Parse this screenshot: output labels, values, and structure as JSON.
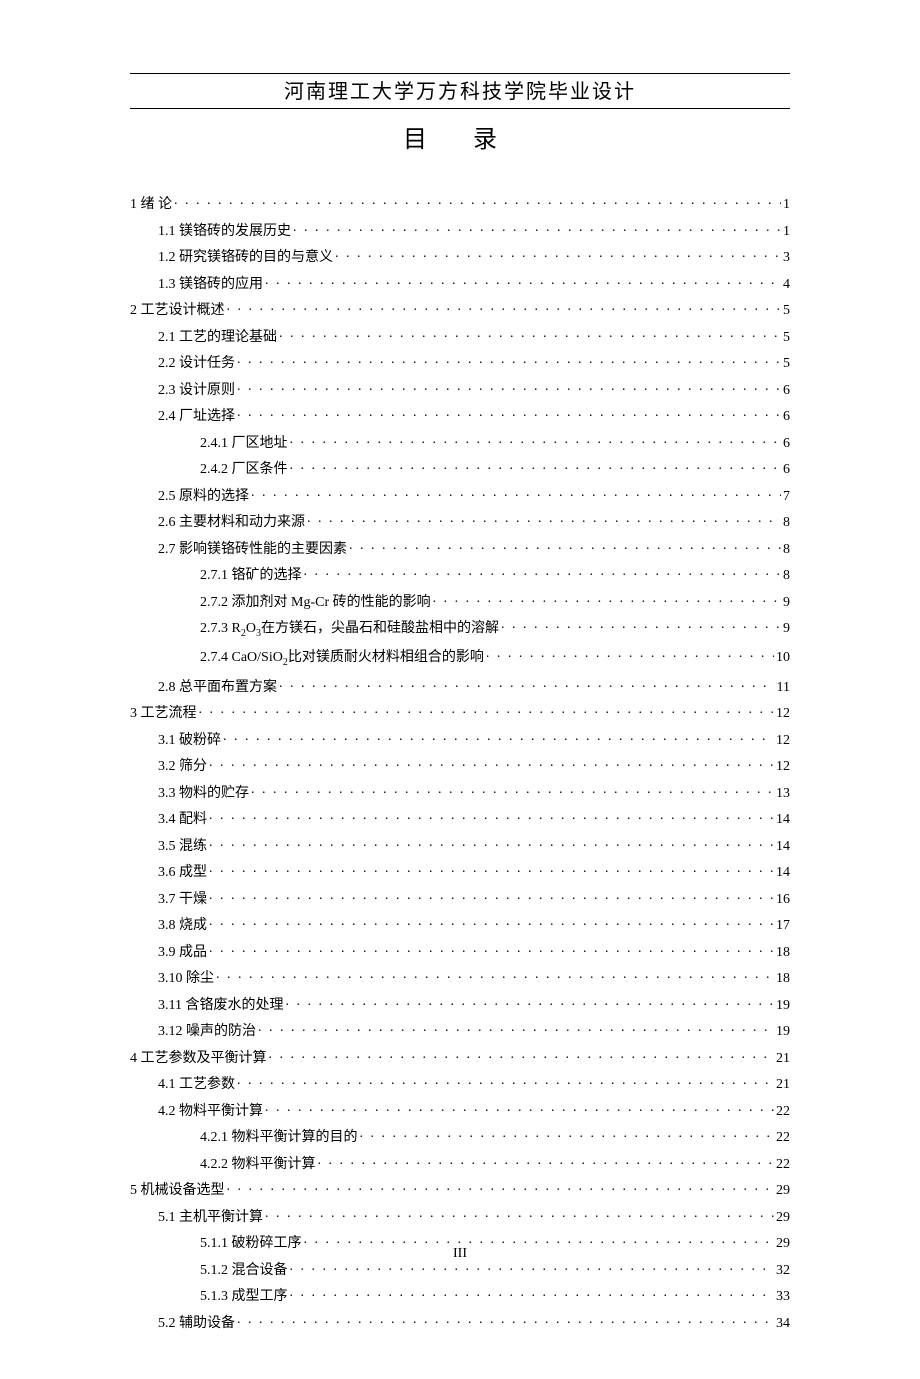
{
  "header": "河南理工大学万方科技学院毕业设计",
  "title": "目  录",
  "page_number": "III",
  "toc": [
    {
      "level": 1,
      "label": "1 绪  论",
      "sub": [],
      "page": "1"
    },
    {
      "level": 2,
      "label": "1.1 镁铬砖的发展历史",
      "sub": [],
      "page": "1"
    },
    {
      "level": 2,
      "label": "1.2 研究镁铬砖的目的与意义",
      "sub": [],
      "page": "3"
    },
    {
      "level": 2,
      "label": "1.3 镁铬砖的应用",
      "sub": [],
      "page": "4"
    },
    {
      "level": 1,
      "label": "2 工艺设计概述",
      "sub": [],
      "page": "5"
    },
    {
      "level": 2,
      "label": "2.1 工艺的理论基础",
      "sub": [],
      "page": "5"
    },
    {
      "level": 2,
      "label": "2.2 设计任务",
      "sub": [],
      "page": "5"
    },
    {
      "level": 2,
      "label": "2.3 设计原则",
      "sub": [],
      "page": "6"
    },
    {
      "level": 2,
      "label": "2.4 厂址选择",
      "sub": [],
      "page": "6"
    },
    {
      "level": 3,
      "label": "2.4.1 厂区地址",
      "sub": [],
      "page": "6"
    },
    {
      "level": 3,
      "label": "2.4.2 厂区条件",
      "sub": [],
      "page": "6"
    },
    {
      "level": 2,
      "label": "2.5 原料的选择",
      "sub": [],
      "page": "7"
    },
    {
      "level": 2,
      "label": "2.6 主要材料和动力来源",
      "sub": [],
      "page": "8"
    },
    {
      "level": 2,
      "label": "2.7 影响镁铬砖性能的主要因素",
      "sub": [],
      "page": "8"
    },
    {
      "level": 3,
      "label": "2.7.1 铬矿的选择",
      "sub": [],
      "page": "8"
    },
    {
      "level": 3,
      "label": "2.7.2 添加剂对 Mg-Cr 砖的性能的影响",
      "sub": [],
      "page": "9"
    },
    {
      "level": 3,
      "label": "2.7.3 R",
      "sub": [
        {
          "t": "sub",
          "v": "2"
        },
        {
          "t": "span",
          "v": "O"
        },
        {
          "t": "sub",
          "v": "3"
        },
        {
          "t": "span",
          "v": "在方镁石，尖晶石和硅酸盐相中的溶解"
        }
      ],
      "page": "9"
    },
    {
      "level": 3,
      "label": "2.7.4 CaO/SiO",
      "sub": [
        {
          "t": "sub",
          "v": "2"
        },
        {
          "t": "span",
          "v": "比对镁质耐火材料相组合的影响"
        }
      ],
      "page": "10"
    },
    {
      "level": 2,
      "label": "2.8 总平面布置方案",
      "sub": [],
      "page": "11"
    },
    {
      "level": 1,
      "label": "3 工艺流程",
      "sub": [],
      "page": "12"
    },
    {
      "level": 2,
      "label": "3.1 破粉碎",
      "sub": [],
      "page": "12"
    },
    {
      "level": 2,
      "label": "3.2 筛分",
      "sub": [],
      "page": "12"
    },
    {
      "level": 2,
      "label": "3.3 物料的贮存",
      "sub": [],
      "page": "13"
    },
    {
      "level": 2,
      "label": "3.4 配料",
      "sub": [],
      "page": "14"
    },
    {
      "level": 2,
      "label": "3.5 混练",
      "sub": [],
      "page": "14"
    },
    {
      "level": 2,
      "label": "3.6 成型",
      "sub": [],
      "page": "14"
    },
    {
      "level": 2,
      "label": "3.7 干燥",
      "sub": [],
      "page": "16"
    },
    {
      "level": 2,
      "label": "3.8 烧成",
      "sub": [],
      "page": "17"
    },
    {
      "level": 2,
      "label": "3.9 成品",
      "sub": [],
      "page": "18"
    },
    {
      "level": 2,
      "label": "3.10 除尘",
      "sub": [],
      "page": "18"
    },
    {
      "level": 2,
      "label": "3.11 含铬废水的处理",
      "sub": [],
      "page": "19"
    },
    {
      "level": 2,
      "label": "3.12 噪声的防治",
      "sub": [],
      "page": "19"
    },
    {
      "level": 1,
      "label": "4 工艺参数及平衡计算",
      "sub": [],
      "page": "21"
    },
    {
      "level": 2,
      "label": "4.1 工艺参数",
      "sub": [],
      "page": "21"
    },
    {
      "level": 2,
      "label": "4.2 物料平衡计算",
      "sub": [],
      "page": "22"
    },
    {
      "level": 3,
      "label": "4.2.1 物料平衡计算的目的",
      "sub": [],
      "page": "22"
    },
    {
      "level": 3,
      "label": "4.2.2 物料平衡计算",
      "sub": [],
      "page": "22"
    },
    {
      "level": 1,
      "label": "5 机械设备选型",
      "sub": [],
      "page": "29"
    },
    {
      "level": 2,
      "label": "5.1 主机平衡计算",
      "sub": [],
      "page": "29"
    },
    {
      "level": 3,
      "label": "5.1.1 破粉碎工序",
      "sub": [],
      "page": "29"
    },
    {
      "level": 3,
      "label": "5.1.2 混合设备",
      "sub": [],
      "page": "32"
    },
    {
      "level": 3,
      "label": "5.1.3 成型工序",
      "sub": [],
      "page": "33"
    },
    {
      "level": 2,
      "label": "5.2 辅助设备",
      "sub": [],
      "page": "34"
    }
  ]
}
